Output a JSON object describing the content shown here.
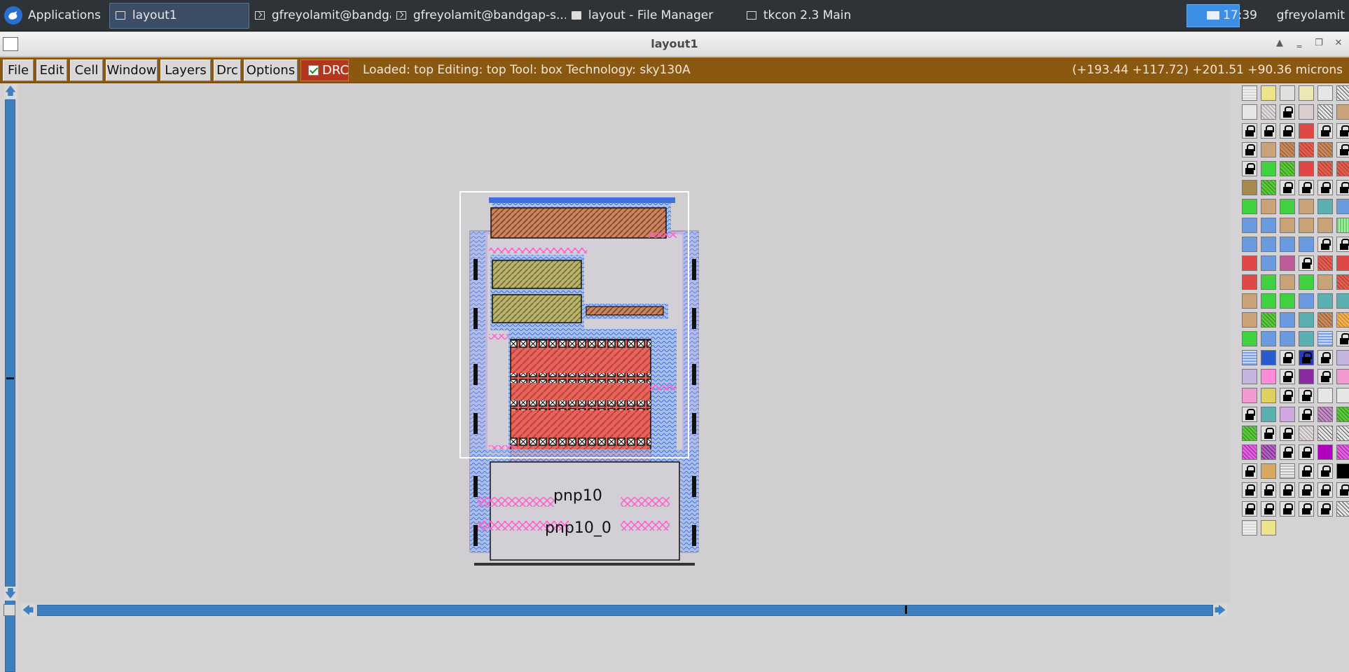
{
  "taskbar": {
    "apps_label": "Applications",
    "tasks": [
      {
        "label": "layout1",
        "icon": "window-icon"
      },
      {
        "label": "gfreyolamit@bandgap-s...",
        "icon": "terminal-icon"
      },
      {
        "label": "gfreyolamit@bandgap-s...",
        "icon": "terminal-icon"
      },
      {
        "label": "layout - File Manager",
        "icon": "folder-icon"
      },
      {
        "label": "tkcon 2.3 Main",
        "icon": "window-icon"
      }
    ],
    "clock": "17:39",
    "user": "gfreyolamit"
  },
  "window": {
    "title": "layout1"
  },
  "menubar": {
    "items": [
      "File",
      "Edit",
      "Cell",
      "Window",
      "Layers",
      "Drc",
      "Options"
    ],
    "drc_toggle": "DRC",
    "drc_checked": true,
    "status": "Loaded: top Editing: top Tool: box  Technology: sky130A",
    "coords": "(+193.44 +117.72) +201.51 +90.36 microns"
  },
  "layout": {
    "labels": [
      "pnp10",
      "pnp10_0"
    ]
  },
  "colors": {
    "menubar": "#8b5812",
    "scrollbar": "#3e7fbf",
    "drc": "#b2371e",
    "poly_red": "#e8645a",
    "diff_green": "#3fd13f",
    "metal_pink": "#ff66cc",
    "metal_blue": "#4f8fff",
    "nwell_lavender": "#c3a8e0"
  },
  "palette": {
    "swatches": [
      "dots",
      "yellow",
      "box",
      "ltyellow",
      "ltgray",
      "hatch",
      "ltgray",
      "hatchgray",
      "lock",
      "pinkgray",
      "hatch",
      "tan",
      "lock",
      "lock",
      "lock",
      "red",
      "lock",
      "lock",
      "lock",
      "tan",
      "tanhatch",
      "redhatch",
      "tanhatch",
      "lock",
      "lock",
      "green",
      "greenhatch",
      "red",
      "redhatch",
      "redhatch",
      "olive",
      "greenhatch",
      "lock",
      "lock",
      "lock",
      "lock",
      "green",
      "tan",
      "green",
      "tan",
      "tealx",
      "bluex",
      "bluex",
      "bluex",
      "tan",
      "tan",
      "tan",
      "greendot",
      "bluex",
      "bluex",
      "bluex",
      "bluex",
      "lock",
      "lock",
      "red",
      "bluex",
      "redx",
      "lock",
      "redhatch",
      "red",
      "red",
      "green",
      "tan",
      "green",
      "tan",
      "redhatch",
      "tan",
      "green",
      "green",
      "bluex",
      "tealx",
      "tealx",
      "tan",
      "greenhatch",
      "bluex",
      "tealx",
      "tanhatch",
      "orangehatch",
      "green",
      "bluex",
      "bluex",
      "tealx",
      "bluewave",
      "lock",
      "bluewave",
      "bluedense",
      "lock",
      "bluelock",
      "lock",
      "lavender",
      "lavender",
      "pink",
      "lock",
      "purple",
      "lock",
      "pinkx",
      "pinkx",
      "yellowx",
      "lock",
      "lock",
      "ltgray",
      "ltgray",
      "lock",
      "tealx",
      "purpledot",
      "lock",
      "hatchpurple",
      "greenhatch",
      "greenhatch",
      "lock",
      "lock",
      "hatchgray",
      "hatch",
      "hatch",
      "magentahatch",
      "purplehatch",
      "lock",
      "lock",
      "magenta",
      "magentahatch",
      "lock",
      "orangedot",
      "graywave",
      "lock",
      "lock",
      "black",
      "lock",
      "lock",
      "lock",
      "lock",
      "lock",
      "lock",
      "lock",
      "lock",
      "lock",
      "lock",
      "lock",
      "hatch",
      "dots",
      "yellow"
    ]
  }
}
